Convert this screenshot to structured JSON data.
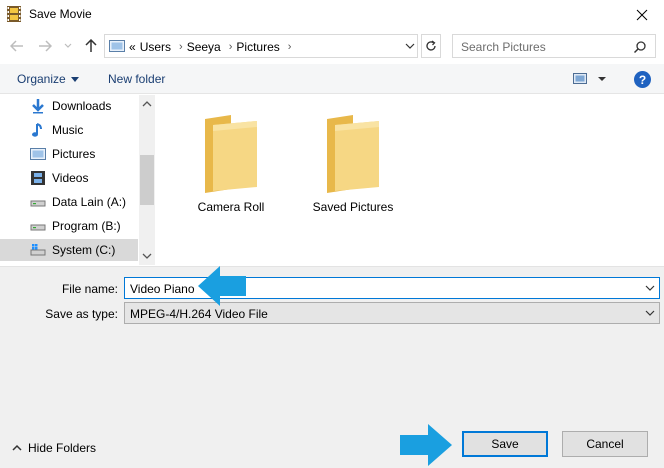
{
  "window": {
    "title": "Save Movie",
    "icon": "film-strip-icon"
  },
  "nav": {
    "breadcrumbs": [
      "«",
      "Users",
      "Seeya",
      "Pictures"
    ],
    "search_placeholder": "Search Pictures"
  },
  "toolbar": {
    "organize_label": "Organize",
    "new_folder_label": "New folder",
    "help_label": "?"
  },
  "sidebar": {
    "items": [
      {
        "label": "Downloads",
        "icon": "download-arrow-icon"
      },
      {
        "label": "Music",
        "icon": "music-note-icon"
      },
      {
        "label": "Pictures",
        "icon": "pictures-icon"
      },
      {
        "label": "Videos",
        "icon": "film-strip-icon"
      },
      {
        "label": "Data Lain (A:)",
        "icon": "drive-icon"
      },
      {
        "label": "Program (B:)",
        "icon": "drive-icon"
      },
      {
        "label": "System (C:)",
        "icon": "system-drive-icon",
        "selected": true
      }
    ]
  },
  "folders": [
    {
      "name": "Camera Roll"
    },
    {
      "name": "Saved Pictures"
    }
  ],
  "form": {
    "file_name_label": "File name:",
    "file_name_value": "Video Piano",
    "save_as_type_label": "Save as type:",
    "save_as_type_value": "MPEG-4/H.264 Video File"
  },
  "footer": {
    "hide_folders_label": "Hide Folders",
    "save_label": "Save",
    "cancel_label": "Cancel"
  },
  "colors": {
    "accent": "#0078d7",
    "annotation_arrow": "#1a9fe0",
    "folder": "#f3d57a",
    "link": "#1a3e72"
  }
}
